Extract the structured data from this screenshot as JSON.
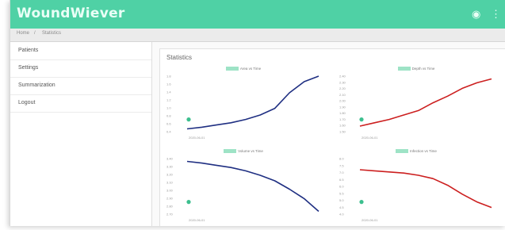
{
  "app": {
    "title": "WoundWiever"
  },
  "header": {
    "icons": [
      "camera-icon",
      "menu-icon"
    ]
  },
  "breadcrumb": [
    "Home",
    "/",
    "Statistics"
  ],
  "sidebar": {
    "items": [
      {
        "label": "Patients"
      },
      {
        "label": "Settings"
      },
      {
        "label": "Summarization"
      },
      {
        "label": "Logout"
      }
    ]
  },
  "main": {
    "title": "Statistics"
  },
  "colors": {
    "accent": "#4fd1a5",
    "blue": "#1f2f82",
    "red": "#cc1f1f",
    "dot": "#3cbf8e"
  },
  "chart_data": [
    {
      "type": "line",
      "legend": "Area vs Time",
      "color": "#1f2f82",
      "y_ticks": [
        "1.8",
        "1.6",
        "1.4",
        "1.2",
        "1.0",
        "0.8",
        "0.6",
        "0.4"
      ],
      "x_tick": "2020-06-01",
      "values": [
        0.05,
        0.08,
        0.12,
        0.16,
        0.22,
        0.3,
        0.42,
        0.7,
        0.9,
        1.0
      ]
    },
    {
      "type": "line",
      "legend": "Depth vs Time",
      "color": "#cc1f1f",
      "y_ticks": [
        "2.40",
        "2.30",
        "2.20",
        "2.10",
        "2.00",
        "1.90",
        "1.80",
        "1.70",
        "1.60",
        "1.50"
      ],
      "x_tick": "2020-06-01",
      "values": [
        0.1,
        0.16,
        0.22,
        0.3,
        0.38,
        0.52,
        0.64,
        0.78,
        0.88,
        0.95
      ]
    },
    {
      "type": "line",
      "legend": "Volume vs Time",
      "color": "#1f2f82",
      "y_ticks": [
        "3.40",
        "3.30",
        "3.20",
        "3.10",
        "3.00",
        "2.90",
        "2.80",
        "2.70"
      ],
      "x_tick": "2020-06-01",
      "values": [
        0.95,
        0.92,
        0.88,
        0.84,
        0.78,
        0.7,
        0.6,
        0.45,
        0.28,
        0.05
      ]
    },
    {
      "type": "line",
      "legend": "Infection vs Time",
      "color": "#cc1f1f",
      "y_ticks": [
        "8.0",
        "7.5",
        "7.0",
        "6.5",
        "6.0",
        "5.5",
        "5.0",
        "4.5",
        "4.0"
      ],
      "x_tick": "2020-06-01",
      "values": [
        0.8,
        0.78,
        0.76,
        0.74,
        0.7,
        0.64,
        0.52,
        0.36,
        0.22,
        0.12
      ]
    }
  ]
}
